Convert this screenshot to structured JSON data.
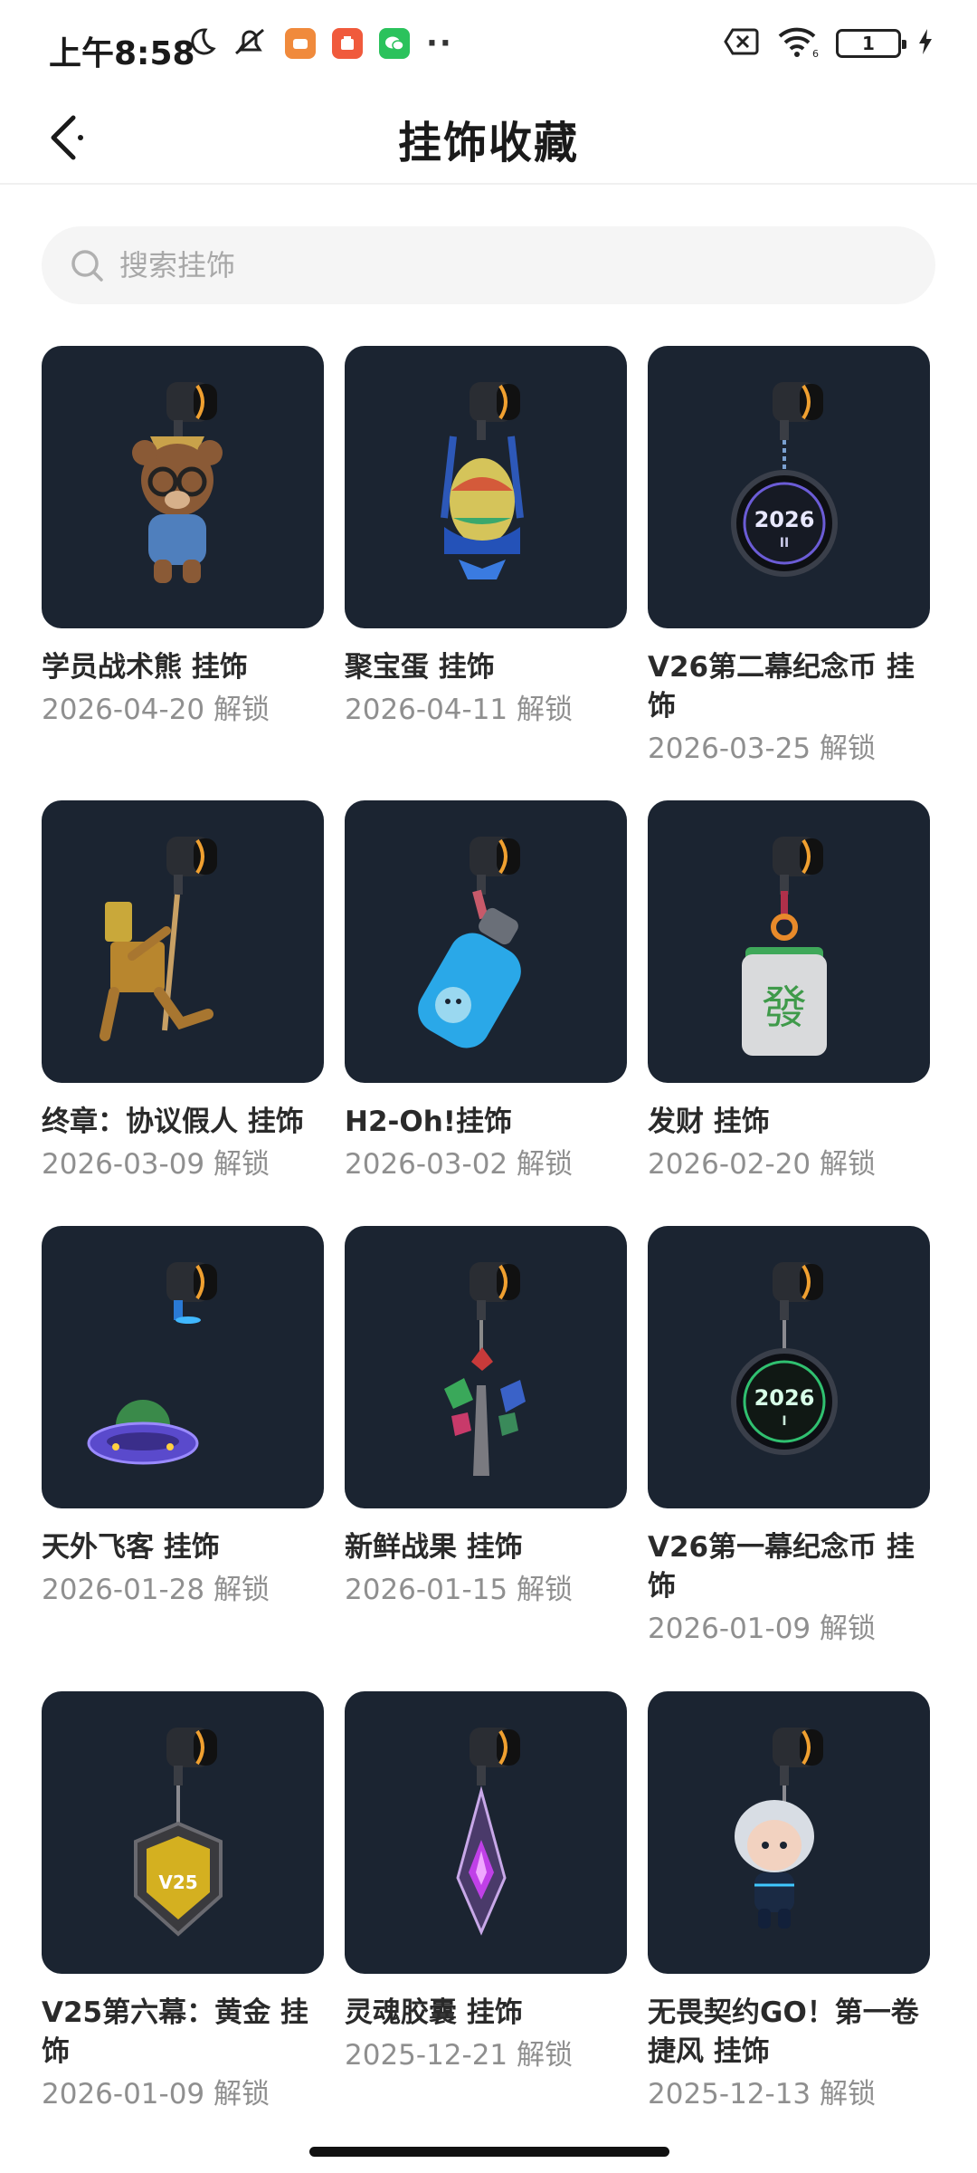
{
  "status_bar": {
    "time": "上午8:58",
    "battery": "1"
  },
  "header": {
    "title": "挂饰收藏"
  },
  "search": {
    "placeholder": "搜索挂饰"
  },
  "charms": [
    {
      "name": "学员战术熊 挂饰",
      "date": "2026-04-20 解锁"
    },
    {
      "name": "聚宝蛋 挂饰",
      "date": "2026-04-11 解锁"
    },
    {
      "name": "V26第二幕纪念币 挂饰",
      "date": "2026-03-25 解锁"
    },
    {
      "name": "终章：协议假人 挂饰",
      "date": "2026-03-09 解锁"
    },
    {
      "name": "H2-Oh!挂饰",
      "date": "2026-03-02 解锁"
    },
    {
      "name": "发财 挂饰",
      "date": "2026-02-20 解锁"
    },
    {
      "name": "天外飞客 挂饰",
      "date": "2026-01-28 解锁"
    },
    {
      "name": "新鲜战果 挂饰",
      "date": "2026-01-15 解锁"
    },
    {
      "name": "V26第一幕纪念币 挂饰",
      "date": "2026-01-09 解锁"
    },
    {
      "name": "V25第六幕：黄金 挂饰",
      "date": "2026-01-09 解锁"
    },
    {
      "name": "灵魂胶囊 挂饰",
      "date": "2025-12-21 解锁"
    },
    {
      "name": "无畏契约GO！第一卷 捷风 挂饰",
      "date": "2025-12-13 解锁"
    }
  ],
  "charm_art": {
    "coin_2026_ii": "2026",
    "coin_2026_ii_sub": "II",
    "coin_2026_i": "2026",
    "coin_2026_i_sub": "I",
    "mahjong_tile": "發",
    "v25_badge": "V25"
  },
  "colors": {
    "card_bg": "#1b2431",
    "accent_orange": "#f0a030",
    "text_primary": "#2a2a2a",
    "text_secondary": "#8f8f8f",
    "search_bg": "#f5f5f5"
  },
  "icons": {
    "back": "back-arrow-icon",
    "search": "search-icon",
    "moon": "moon-icon",
    "mute": "mute-icon",
    "wifi": "wifi-icon",
    "sim": "no-sim-icon",
    "charging": "charging-icon"
  }
}
